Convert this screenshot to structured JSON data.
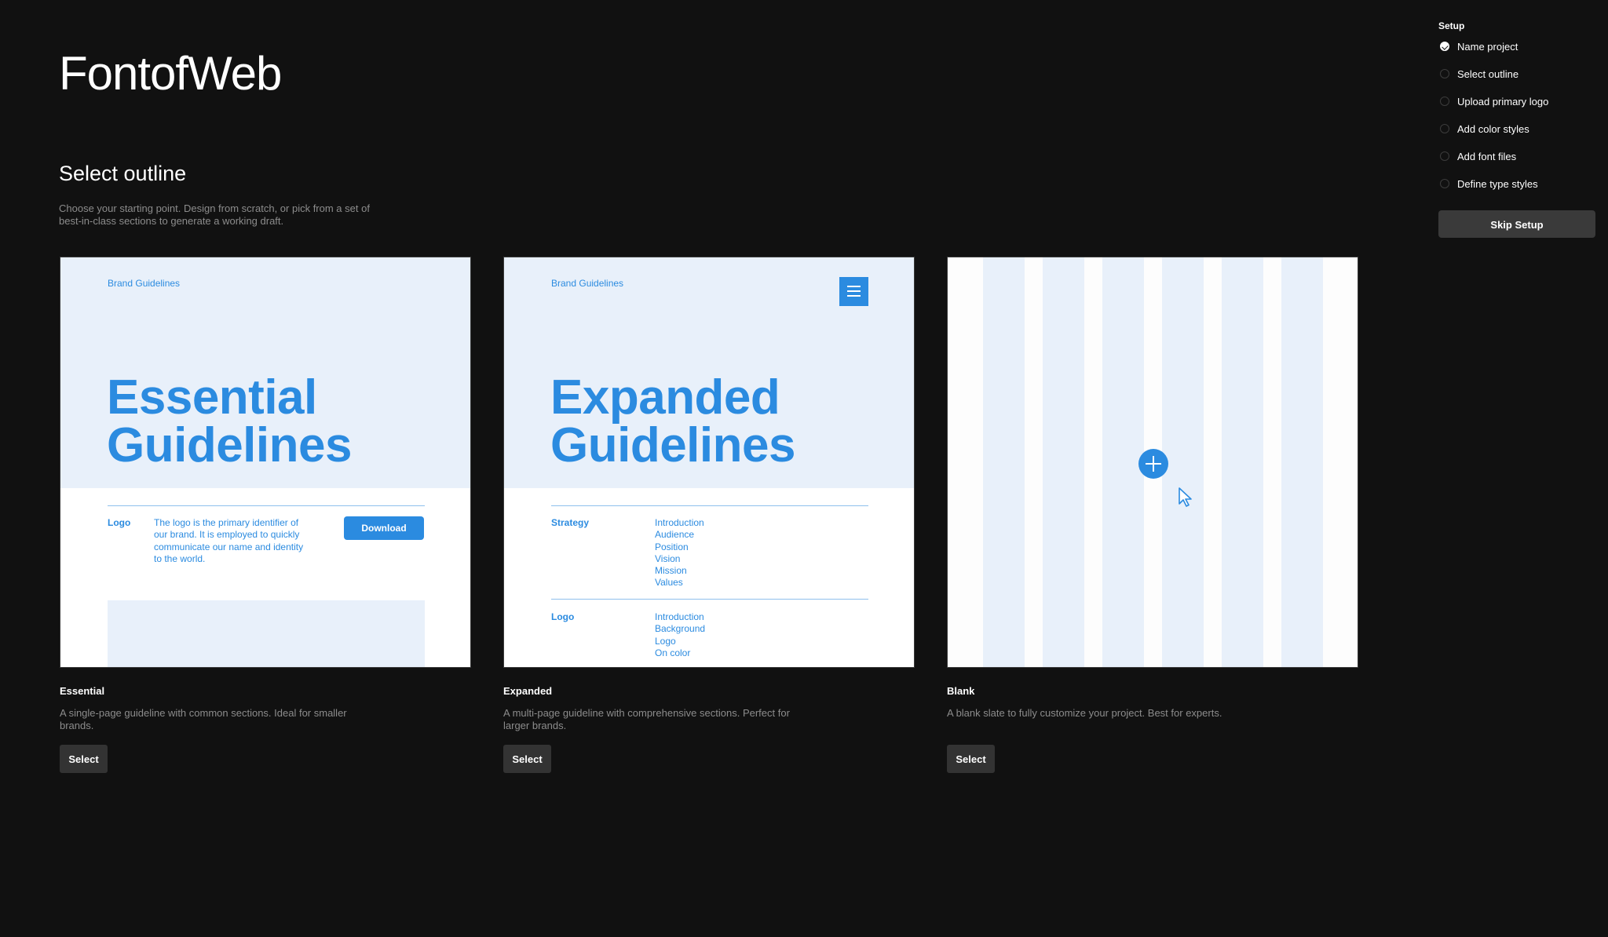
{
  "brand": "FontofWeb",
  "section": {
    "title": "Select outline",
    "description": "Choose your starting point. Design from scratch, or pick from a set of best-in-class sections to generate a working draft."
  },
  "cards": [
    {
      "name": "Essential",
      "description": "A single-page guideline with common sections. Ideal for smaller brands.",
      "select_label": "Select",
      "preview": {
        "eyebrow": "Brand Guidelines",
        "title_line1": "Essential",
        "title_line2": "Guidelines",
        "row_label": "Logo",
        "row_text": "The logo is the primary identifier of our brand. It is employed to quickly communicate our name and identity to the world.",
        "button": "Download"
      }
    },
    {
      "name": "Expanded",
      "description": "A multi-page guideline with comprehensive sections. Perfect for larger brands.",
      "select_label": "Select",
      "preview": {
        "eyebrow": "Brand Guidelines",
        "title_line1": "Expanded",
        "title_line2": "Guidelines",
        "sections": [
          {
            "label": "Strategy",
            "items": [
              "Introduction",
              "Audience",
              "Position",
              "Vision",
              "Mission",
              "Values"
            ]
          },
          {
            "label": "Logo",
            "items": [
              "Introduction",
              "Background",
              "Logo",
              "On color"
            ]
          }
        ]
      }
    },
    {
      "name": "Blank",
      "description": "A blank slate to fully customize your project. Best for experts.",
      "select_label": "Select"
    }
  ],
  "setup": {
    "title": "Setup",
    "steps": [
      {
        "label": "Name project",
        "done": true
      },
      {
        "label": "Select outline",
        "done": false
      },
      {
        "label": "Upload primary logo",
        "done": false
      },
      {
        "label": "Add color styles",
        "done": false
      },
      {
        "label": "Add font files",
        "done": false
      },
      {
        "label": "Define type styles",
        "done": false
      }
    ],
    "skip_label": "Skip Setup"
  },
  "colors": {
    "background": "#111111",
    "accent": "#2b8be0",
    "preview_tint": "#e8f0fa",
    "button_dark": "#333333"
  }
}
